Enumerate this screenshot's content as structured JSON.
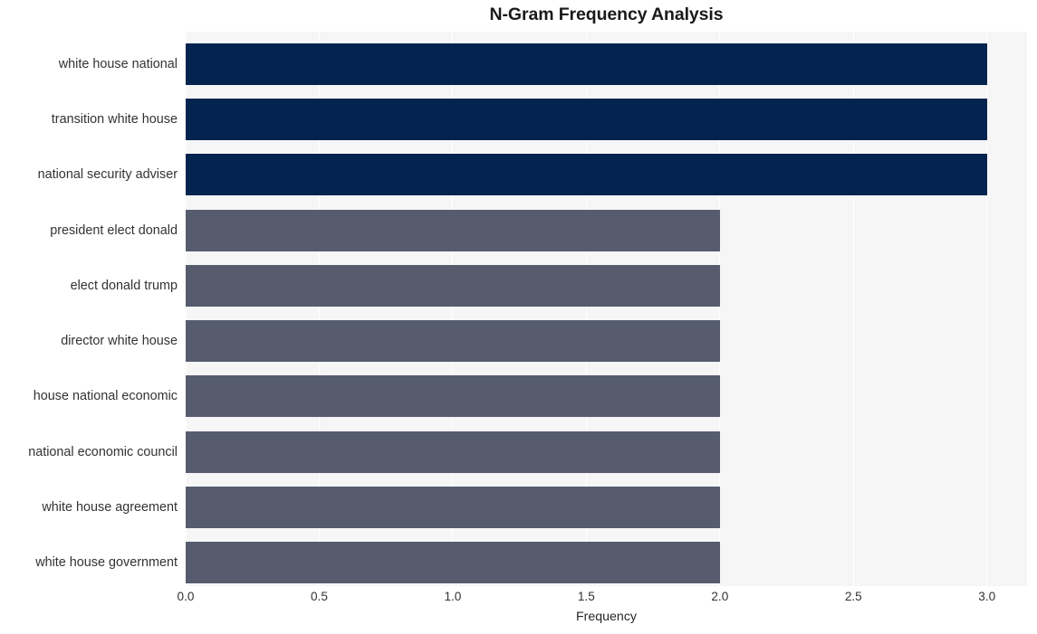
{
  "chart_data": {
    "type": "bar",
    "orientation": "horizontal",
    "title": "N-Gram Frequency Analysis",
    "xlabel": "Frequency",
    "ylabel": "",
    "xlim": [
      0.0,
      3.15
    ],
    "ylim": [
      0,
      10
    ],
    "grid": "vertical-white-on-light-gray",
    "legend": "none",
    "categories": [
      "white house national",
      "transition white house",
      "national security adviser",
      "president elect donald",
      "elect donald trump",
      "director white house",
      "house national economic",
      "national economic council",
      "white house agreement",
      "white house government"
    ],
    "values": [
      3,
      3,
      3,
      2,
      2,
      2,
      2,
      2,
      2,
      2
    ],
    "bar_colors": [
      "#042450",
      "#042450",
      "#042450",
      "#565c6e",
      "#565c6e",
      "#565c6e",
      "#565c6e",
      "#565c6e",
      "#565c6e",
      "#565c6e"
    ],
    "xticks": [
      {
        "value": 0.0,
        "label": "0.0"
      },
      {
        "value": 0.5,
        "label": "0.5"
      },
      {
        "value": 1.0,
        "label": "1.0"
      },
      {
        "value": 1.5,
        "label": "1.5"
      },
      {
        "value": 2.0,
        "label": "2.0"
      },
      {
        "value": 2.5,
        "label": "2.5"
      },
      {
        "value": 3.0,
        "label": "3.0"
      }
    ],
    "colors": {
      "plot_background": "#f6f6f7",
      "figure_background": "#ffffff",
      "gridline": "#ffffff",
      "tick_label": "#333333",
      "title": "#1a1a1a",
      "bar_high": "#042450",
      "bar_low": "#565c6e"
    }
  }
}
